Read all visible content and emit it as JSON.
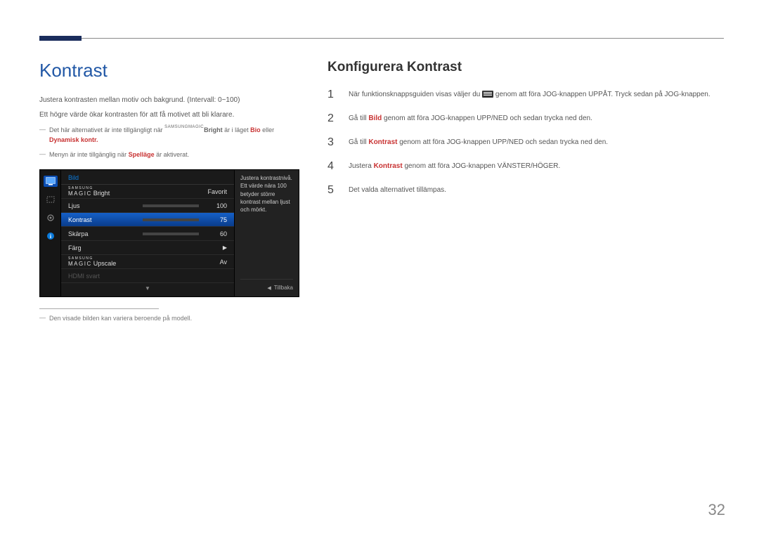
{
  "page_number": "32",
  "left": {
    "title": "Kontrast",
    "intro1": "Justera kontrasten mellan motiv och bakgrund. (Intervall: 0~100)",
    "intro2": "Ett högre värde ökar kontrasten för att få motivet att bli klarare.",
    "note1_prefix": "Det här alternativet är inte tillgängligt när ",
    "note1_magic_prefix": "SAMSUNG",
    "note1_magic": "MAGIC",
    "note1_bright": "Bright",
    "note1_mid": " är i läget ",
    "note1_bio": "Bio",
    "note1_eller": " eller ",
    "note1_dyn": "Dynamisk kontr.",
    "note2_prefix": "Menyn är inte tillgänglig när ",
    "note2_spel": "Spelläge",
    "note2_suffix": " är aktiverat.",
    "footnote": "Den visade bilden kan variera beroende på modell."
  },
  "osd": {
    "header": "Bild",
    "rows": {
      "bright_samsung": "SAMSUNG",
      "bright_magic": "MAGIC",
      "bright_suffix": "Bright",
      "bright_value": "Favorit",
      "ljus": "Ljus",
      "ljus_value": "100",
      "kontrast": "Kontrast",
      "kontrast_value": "75",
      "skarpa": "Skärpa",
      "skarpa_value": "60",
      "farg": "Färg",
      "upscale_samsung": "SAMSUNG",
      "upscale_magic": "MAGIC",
      "upscale_suffix": "Upscale",
      "upscale_value": "Av",
      "hdmi": "HDMI svart"
    },
    "desc": "Justera kontrastnivå. Ett värde nära 100 betyder större kontrast mellan ljust och mörkt.",
    "back": "Tillbaka"
  },
  "right": {
    "title": "Konfigurera Kontrast",
    "steps": {
      "s1a": "När funktionsknappsguiden visas väljer du ",
      "s1b": " genom att föra JOG-knappen UPPÅT. Tryck sedan på JOG-knappen.",
      "s2a": "Gå till ",
      "s2_bild": "Bild",
      "s2b": " genom att föra JOG-knappen UPP/NED och sedan trycka ned den.",
      "s3a": "Gå till ",
      "s3_kontrast": "Kontrast",
      "s3b": " genom att föra JOG-knappen UPP/NED och sedan trycka ned den.",
      "s4a": "Justera ",
      "s4_kontrast": "Kontrast",
      "s4b": " genom att föra JOG-knappen VÄNSTER/HÖGER.",
      "s5": "Det valda alternativet tillämpas."
    }
  }
}
